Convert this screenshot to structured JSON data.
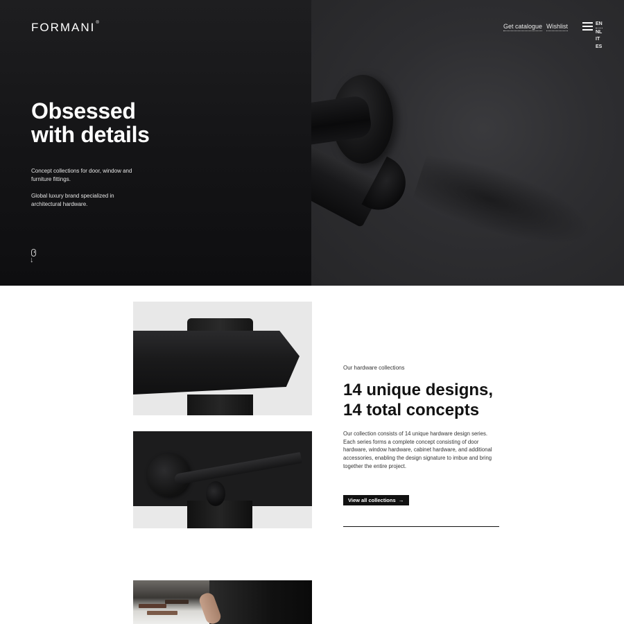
{
  "header": {
    "logo": "FORMANI",
    "logo_mark": "®",
    "links": [
      {
        "label": "Get catalogue"
      },
      {
        "label": "Wishlist"
      }
    ],
    "menu_icon": "hamburger-menu-icon",
    "languages": [
      "EN",
      "NL",
      "IT",
      "ES"
    ],
    "active_language": "EN"
  },
  "hero": {
    "title_line1": "Obsessed",
    "title_line2": "with details",
    "paragraph1": "Concept collections for door, window and furniture fittings.",
    "paragraph2": "Global luxury brand specialized in architectural hardware.",
    "scroll_icons": [
      "mouse-icon",
      "arrow-down-icon"
    ],
    "scroll_arrow": "↓"
  },
  "collections": {
    "eyebrow": "Our hardware collections",
    "title_line1": "14 unique designs,",
    "title_line2": "14 total concepts",
    "body": "Our collection consists of 14 unique hardware design series. Each series forms a complete concept consisting of door hardware, window hardware, cabinet hardware, and additional accessories, enabling the design signature to imbue and bring together the entire project.",
    "cta_label": "View all collections",
    "cta_arrow": "→"
  },
  "colors": {
    "hero_dark": "#141416",
    "hero_right": "#2e2e31",
    "text_dark": "#111111",
    "button_bg": "#111111",
    "page_bg": "#ffffff"
  }
}
